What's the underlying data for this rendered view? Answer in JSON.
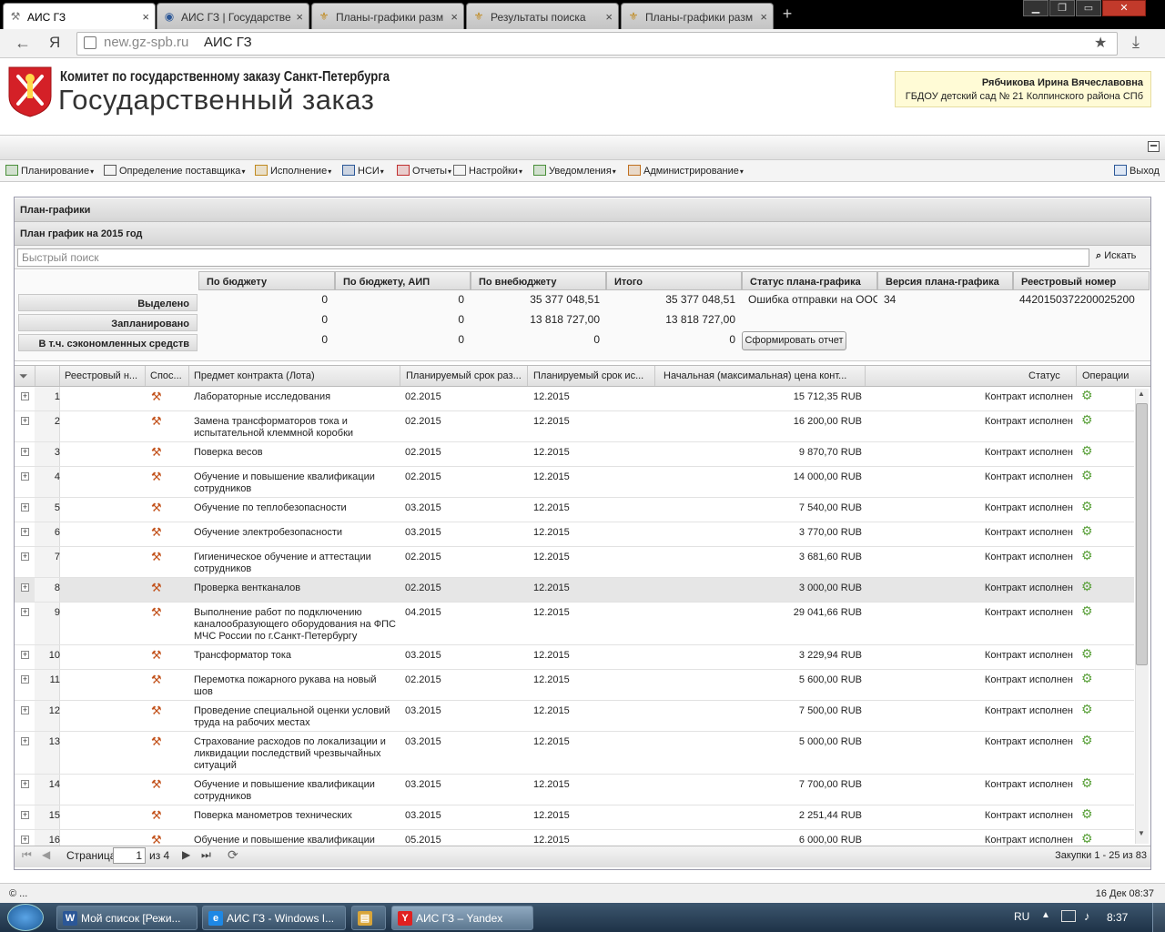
{
  "browser": {
    "tabs": [
      {
        "label": "АИС ГЗ",
        "active": true
      },
      {
        "label": "АИС ГЗ | Государстве",
        "active": false
      },
      {
        "label": "Планы-графики разм",
        "active": false
      },
      {
        "label": "Результаты поиска",
        "active": false
      },
      {
        "label": "Планы-графики разм",
        "active": false
      }
    ],
    "url_domain": "new.gz-spb.ru",
    "url_title": "АИС ГЗ",
    "back_glyph": "←",
    "yandex_glyph": "Я",
    "star_glyph": "★",
    "download_glyph": "⤓"
  },
  "header": {
    "subtitle": "Комитет по государственному заказу Санкт-Петербурга",
    "title": "Государственный заказ",
    "user_name": "Рябчикова Ирина Вячеславовна",
    "user_org": "ГБДОУ детский сад № 21 Колпинского района СПб"
  },
  "menu": {
    "items": [
      {
        "label": "Планирование",
        "icon": "planning-icon"
      },
      {
        "label": "Определение поставщика",
        "icon": "supplier-icon"
      },
      {
        "label": "Исполнение",
        "icon": "execution-icon"
      },
      {
        "label": "НСИ",
        "icon": "book-icon"
      },
      {
        "label": "Отчеты",
        "icon": "report-icon"
      },
      {
        "label": "Настройки",
        "icon": "wrench-icon"
      },
      {
        "label": "Уведомления",
        "icon": "notification-icon"
      },
      {
        "label": "Администрирование",
        "icon": "admin-icon"
      }
    ],
    "exit_label": "Выход"
  },
  "panel": {
    "title": "План-графики",
    "subtitle": "План график на 2015 год",
    "search_placeholder": "Быстрый поиск",
    "search_button": "Искать"
  },
  "summary": {
    "headers": [
      "По бюджету",
      "По бюджету, АИП",
      "По внебюджету",
      "Итого",
      "Статус плана-графика",
      "Версия плана-графика",
      "Реестровый номер"
    ],
    "rows": [
      {
        "label": "Выделено",
        "values": [
          "0",
          "0",
          "35 377 048,51",
          "35 377 048,51"
        ]
      },
      {
        "label": "Запланировано",
        "values": [
          "0",
          "0",
          "13 818 727,00",
          "13 818 727,00"
        ]
      },
      {
        "label": "В т.ч. сэкономленных средств",
        "values": [
          "0",
          "0",
          "0",
          "0"
        ]
      }
    ],
    "status": "Ошибка отправки на ООС",
    "version": "34",
    "registry_number": "4420150372200025200",
    "report_button": "Сформировать отчет"
  },
  "grid": {
    "columns": [
      "Реестровый н...",
      "Спос...",
      "Предмет контракта (Лота)",
      "Планируемый срок раз...",
      "Планируемый срок ис...",
      "Начальная (максимальная) цена конт...",
      "Статус",
      "Операции"
    ],
    "rows": [
      {
        "n": "1",
        "subject": [
          "Лабораторные исследования"
        ],
        "start": "02.2015",
        "end": "12.2015",
        "price": "15 712,35 RUB",
        "status": "Контракт исполнен"
      },
      {
        "n": "2",
        "subject": [
          "Замена трансформаторов тока и",
          "испытательной клеммной коробки"
        ],
        "start": "02.2015",
        "end": "12.2015",
        "price": "16 200,00 RUB",
        "status": "Контракт исполнен"
      },
      {
        "n": "3",
        "subject": [
          "Поверка весов"
        ],
        "start": "02.2015",
        "end": "12.2015",
        "price": "9 870,70 RUB",
        "status": "Контракт исполнен"
      },
      {
        "n": "4",
        "subject": [
          "Обучение и повышение квалификации",
          "сотрудников"
        ],
        "start": "02.2015",
        "end": "12.2015",
        "price": "14 000,00 RUB",
        "status": "Контракт исполнен"
      },
      {
        "n": "5",
        "subject": [
          "Обучение по теплобезопасности"
        ],
        "start": "03.2015",
        "end": "12.2015",
        "price": "7 540,00 RUB",
        "status": "Контракт исполнен"
      },
      {
        "n": "6",
        "subject": [
          "Обучение электробезопасности"
        ],
        "start": "03.2015",
        "end": "12.2015",
        "price": "3 770,00 RUB",
        "status": "Контракт исполнен"
      },
      {
        "n": "7",
        "subject": [
          "Гигиеническое обучение и аттестации",
          "сотрудников"
        ],
        "start": "02.2015",
        "end": "12.2015",
        "price": "3 681,60 RUB",
        "status": "Контракт исполнен"
      },
      {
        "n": "8",
        "subject": [
          "Проверка вентканалов"
        ],
        "start": "02.2015",
        "end": "12.2015",
        "price": "3 000,00 RUB",
        "status": "Контракт исполнен",
        "highlight": true
      },
      {
        "n": "9",
        "subject": [
          "Выполнение работ по подключению",
          "каналообразующего оборудования на ФПС",
          "МЧС России по г.Санкт-Петербургу"
        ],
        "start": "04.2015",
        "end": "12.2015",
        "price": "29 041,66 RUB",
        "status": "Контракт исполнен"
      },
      {
        "n": "10",
        "subject": [
          "Трансформатор тока"
        ],
        "start": "03.2015",
        "end": "12.2015",
        "price": "3 229,94 RUB",
        "status": "Контракт исполнен"
      },
      {
        "n": "11",
        "subject": [
          "Перемотка пожарного рукава на новый",
          "шов"
        ],
        "start": "02.2015",
        "end": "12.2015",
        "price": "5 600,00 RUB",
        "status": "Контракт исполнен"
      },
      {
        "n": "12",
        "subject": [
          "Проведение специальной оценки условий",
          "труда на рабочих местах"
        ],
        "start": "03.2015",
        "end": "12.2015",
        "price": "7 500,00 RUB",
        "status": "Контракт исполнен"
      },
      {
        "n": "13",
        "subject": [
          "Страхование расходов по локализации и",
          "ликвидации последствий чрезвычайных",
          "ситуаций"
        ],
        "start": "03.2015",
        "end": "12.2015",
        "price": "5 000,00 RUB",
        "status": "Контракт исполнен"
      },
      {
        "n": "14",
        "subject": [
          "Обучение и повышение квалификации",
          "сотрудников"
        ],
        "start": "03.2015",
        "end": "12.2015",
        "price": "7 700,00 RUB",
        "status": "Контракт исполнен"
      },
      {
        "n": "15",
        "subject": [
          "Поверка манометров технических"
        ],
        "start": "03.2015",
        "end": "12.2015",
        "price": "2 251,44 RUB",
        "status": "Контракт исполнен"
      },
      {
        "n": "16",
        "subject": [
          "Обучение и повышение квалификации"
        ],
        "start": "05.2015",
        "end": "12.2015",
        "price": "6 000,00 RUB",
        "status": "Контракт исполнен"
      }
    ]
  },
  "pager": {
    "page_label": "Страница",
    "page_value": "1",
    "of_label": "из 4",
    "summary": "Закупки 1 - 25 из 83"
  },
  "statusbar": {
    "left": "© ...",
    "right": "16 Дек 08:37"
  },
  "taskbar": {
    "tasks": [
      {
        "label": "Мой список [Режи...",
        "icon": "W",
        "color": "#2b5797"
      },
      {
        "label": "АИС ГЗ - Windows I...",
        "icon": "e",
        "color": "#1e88e5"
      },
      {
        "label": "",
        "icon": "▤",
        "color": "#d8a53a"
      },
      {
        "label": "АИС ГЗ – Yandex",
        "icon": "Y",
        "color": "#e02020",
        "active": true
      }
    ],
    "lang": "RU",
    "clock": "8:37"
  },
  "colors": {
    "accent_red": "#d42027",
    "ops_green": "#5aa03a"
  }
}
